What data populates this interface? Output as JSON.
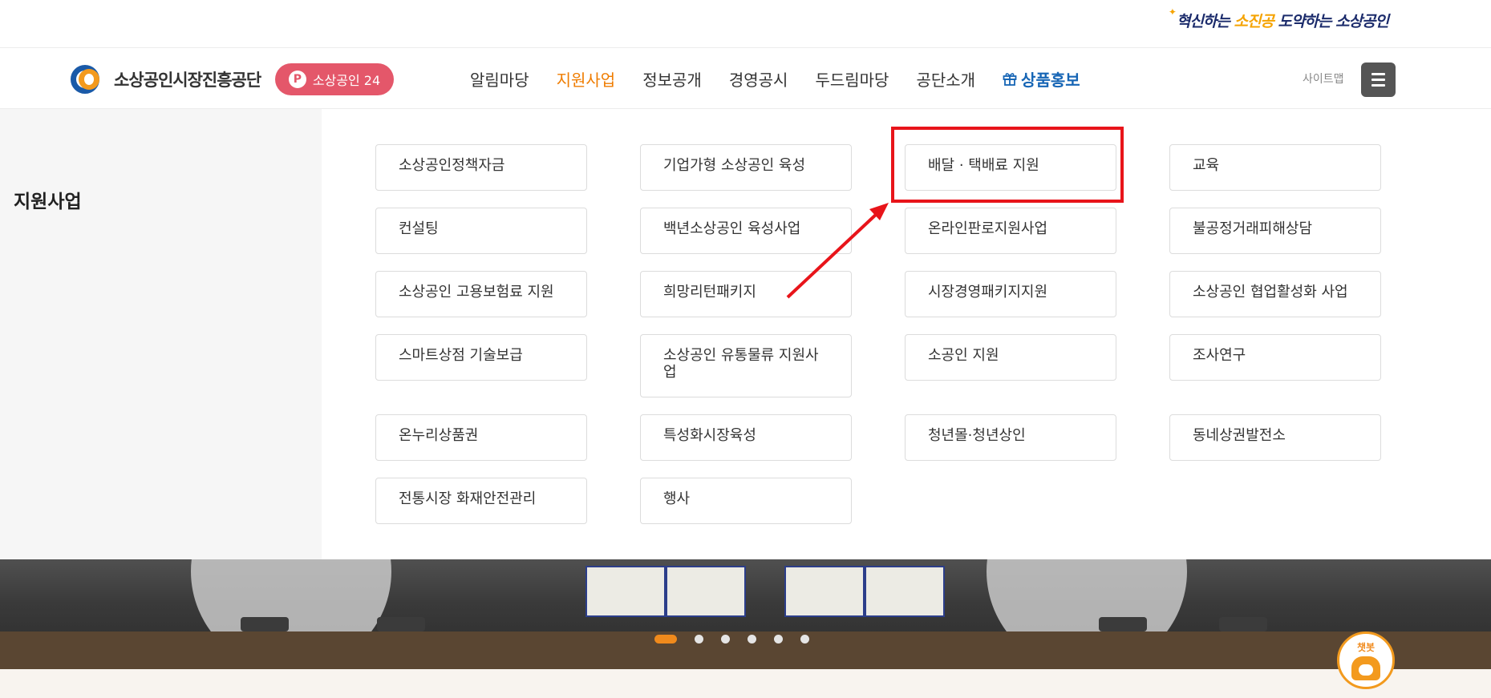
{
  "topbar": {
    "slogan_part1": "혁신하는 ",
    "slogan_highlight": "소진공",
    "slogan_part2": " 도약하는 소상공인"
  },
  "header": {
    "logo_text": "소상공인시장진흥공단",
    "pill_label": "소상공인 24",
    "pill_icon": "P",
    "nav": [
      "알림마당",
      "지원사업",
      "정보공개",
      "경영공시",
      "두드림마당",
      "공단소개"
    ],
    "nav_promo": "상품홍보",
    "sitemap_label": "사이트맵"
  },
  "mega_menu": {
    "title": "지원사업",
    "items": [
      "소상공인정책자금",
      "기업가형 소상공인 육성",
      "배달 · 택배료 지원",
      "교육",
      "컨설팅",
      "백년소상공인 육성사업",
      "온라인판로지원사업",
      "불공정거래피해상담",
      "소상공인 고용보험료 지원",
      "희망리턴패키지",
      "시장경영패키지지원",
      "소상공인 협업활성화 사업",
      "스마트상점 기술보급",
      "소상공인 유통물류 지원사업",
      "소공인 지원",
      "조사연구",
      "온누리상품권",
      "특성화시장육성",
      "청년몰·청년상인",
      "동네상권발전소",
      "전통시장 화재안전관리",
      "행사"
    ]
  },
  "carousel": {
    "slide_count": 6,
    "active_index": 0
  },
  "chatbot": {
    "label": "챗봇"
  },
  "colors": {
    "accent_orange": "#ef7c00",
    "pill_red": "#e4576a",
    "promo_blue": "#1665b5",
    "highlight_red": "#e8141a"
  },
  "icons": [
    "logo-mark-icon",
    "p-icon",
    "gift-icon",
    "hamburger-icon",
    "chatbot-icon"
  ]
}
